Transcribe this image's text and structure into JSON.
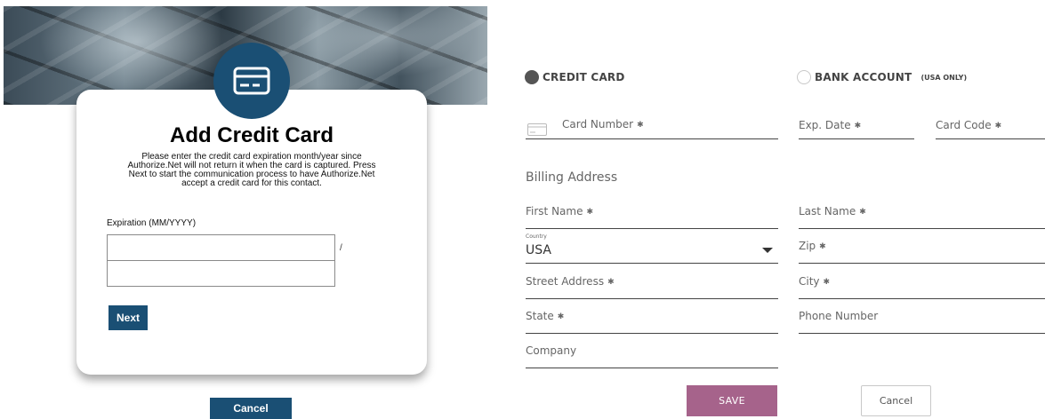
{
  "left": {
    "title": "Add Credit Card",
    "description": "Please enter the credit card expiration month/year since Authorize.Net will not return it when the card is captured. Press Next to start the communication process to have Authorize.Net accept a credit card for this contact.",
    "expiration_label": "Expiration (MM/YYYY)",
    "month_value": "",
    "year_value": "",
    "separator": "/",
    "next_label": "Next",
    "cancel_label": "Cancel",
    "icon": "credit-card-icon"
  },
  "right": {
    "payment_types": [
      {
        "label": "CREDIT CARD",
        "selected": true,
        "note": ""
      },
      {
        "label": "BANK ACCOUNT",
        "selected": false,
        "note": "(USA ONLY)"
      }
    ],
    "card_fields": {
      "card_number": "Card Number",
      "exp_date": "Exp. Date",
      "card_code": "Card Code",
      "required_marker": "✱"
    },
    "billing": {
      "section_title": "Billing Address",
      "first_name": "First Name",
      "last_name": "Last Name",
      "country_label": "Country",
      "country_value": "USA",
      "zip": "Zip",
      "street_address": "Street Address",
      "city": "City",
      "state": "State",
      "phone_number": "Phone Number",
      "company": "Company"
    },
    "save_label": "SAVE",
    "cancel_label": "Cancel"
  },
  "colors": {
    "primary": "#1a4f74",
    "save": "#a6638b"
  }
}
